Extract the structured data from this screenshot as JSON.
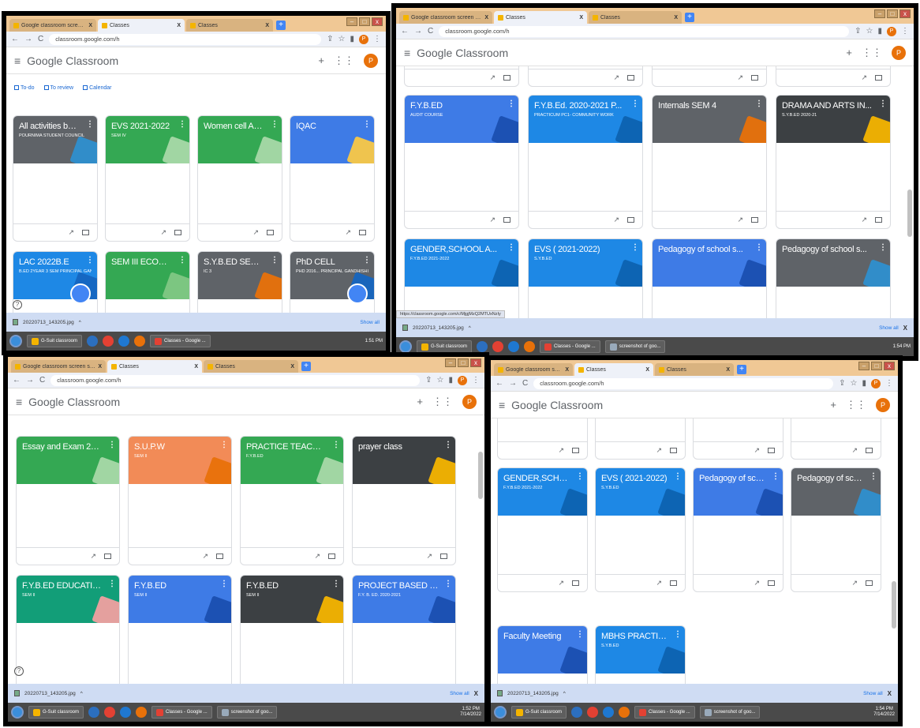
{
  "common": {
    "tabs": [
      {
        "label": "Google classroom screen shots",
        "close": "X"
      },
      {
        "label": "Classes",
        "close": "X"
      },
      {
        "label": "Classes",
        "close": "X"
      }
    ],
    "new_tab": "+",
    "url": "classroom.google.com/h",
    "app_title_g": "Google",
    "app_title_c": " Classroom",
    "avatar_initial": "P",
    "add": "+",
    "apps": "⋮⋮⋮",
    "download_file": "20220713_143205.jpg",
    "download_arrow": "^",
    "show_all": "Show all",
    "download_close": "X",
    "taskbar_gsuite": "G-Suit classroom",
    "taskbar_chrome": "Classes - Google ...",
    "taskbar_screenshot": "screenshot of goo...",
    "date": "7/14/2022",
    "help": "?",
    "more": "⋮",
    "trend": "↗"
  },
  "panel1": {
    "nav": [
      {
        "label": "To-do"
      },
      {
        "label": "To review"
      },
      {
        "label": "Calendar"
      }
    ],
    "time": "1:51 PM",
    "cards": [
      {
        "title": "All activities batch 20...",
        "sub": "Pournima Student council",
        "color": "#5f6368",
        "deco": "#2e8fcf"
      },
      {
        "title": "EVS 2021-2022",
        "sub": "SEM IV",
        "color": "#34a853",
        "deco": "#a8d8a8"
      },
      {
        "title": "Women cell Activities",
        "sub": "",
        "color": "#34a853",
        "deco": "#a8d8a8"
      },
      {
        "title": "IQAC",
        "sub": "",
        "color": "#3e7be6",
        "deco": "#f9c846"
      },
      {
        "title": "LAC 2022B.E",
        "sub": "B.Ed 2year 3 sem Principal Gandhishikshan",
        "color": "#1e88e5",
        "deco": "#1565c0"
      },
      {
        "title": "SEM III ECONOMICS",
        "sub": "",
        "color": "#34a853",
        "deco": "#81c784"
      },
      {
        "title": "S.Y.B.ED SEM III",
        "sub": "IC 3",
        "color": "#5f6368",
        "deco": "#e8710a"
      },
      {
        "title": "PhD CELL",
        "sub": "PhD 2016... Principal Gandhishikshan",
        "color": "#5f6368",
        "deco": "#1565c0"
      }
    ]
  },
  "panel2": {
    "status_url": "https://classroom.google.com/c/MjgjMzQ2MTUxNzIy",
    "time": "1:54 PM",
    "cards": [
      {
        "title": "F.Y.B.ED",
        "sub": "AUDIT COURSE",
        "color": "#3e7be6",
        "deco": "#1a4fb0"
      },
      {
        "title": "F.Y.B.Ed. 2020-2021 P...",
        "sub": "PRACTICUM PC1- COMMUNITY WORK",
        "color": "#1e88e5",
        "deco": "#0d62b0"
      },
      {
        "title": "Internals SEM 4",
        "sub": "",
        "color": "#5f6368",
        "deco": "#e8710a"
      },
      {
        "title": "DRAMA AND ARTS IN...",
        "sub": "S.Y.B.ED 2020-21",
        "color": "#3c4043",
        "deco": "#f4b400"
      },
      {
        "title": "GENDER,SCHOOL A...",
        "sub": "F.Y.B.ED 2021-2022",
        "color": "#1e88e5",
        "deco": "#0d62b0"
      },
      {
        "title": "EVS ( 2021-2022)",
        "sub": "S.Y.B.ED",
        "color": "#1e88e5",
        "deco": "#0d62b0"
      },
      {
        "title": "Pedagogy of school s...",
        "sub": "",
        "color": "#3e7be6",
        "deco": "#1a4fb0"
      },
      {
        "title": "Pedagogy of school s...",
        "sub": "",
        "color": "#5f6368",
        "deco": "#2e8fcf"
      }
    ]
  },
  "panel3": {
    "time": "1:52 PM",
    "cards": [
      {
        "title": "Essay and Exam 2021...",
        "sub": "",
        "color": "#34a853",
        "deco": "#a8d8a8"
      },
      {
        "title": "S.U.P.W",
        "sub": "SEM II",
        "color": "#f28b57",
        "deco": "#e8710a"
      },
      {
        "title": "PRACTICE TEACHING",
        "sub": "F.Y.B.ED",
        "color": "#34a853",
        "deco": "#a8d8a8"
      },
      {
        "title": "prayer class",
        "sub": "",
        "color": "#3c4043",
        "deco": "#f4b400"
      },
      {
        "title": "F.Y.B.ED EDUCATION...",
        "sub": "SEM II",
        "color": "#129e78",
        "deco": "#f0a0a0"
      },
      {
        "title": "F.Y.B.ED",
        "sub": "SEM II",
        "color": "#3e7be6",
        "deco": "#1a4fb0"
      },
      {
        "title": "F.Y.B.ED",
        "sub": "SEM II",
        "color": "#3c4043",
        "deco": "#f4b400"
      },
      {
        "title": "PROJECT BASED CO...",
        "sub": "F.Y. B. Ed. 2020-2021",
        "color": "#3e7be6",
        "deco": "#1a4fb0"
      }
    ]
  },
  "panel4": {
    "time": "1:54 PM",
    "cards": [
      {
        "title": "GENDER,SCHOOL A...",
        "sub": "F.Y.B.ED 2021-2022",
        "color": "#1e88e5",
        "deco": "#0d62b0"
      },
      {
        "title": "EVS ( 2021-2022)",
        "sub": "S.Y.B.ED",
        "color": "#1e88e5",
        "deco": "#0d62b0"
      },
      {
        "title": "Pedagogy of school s...",
        "sub": "",
        "color": "#3e7be6",
        "deco": "#1a4fb0"
      },
      {
        "title": "Pedagogy of school s...",
        "sub": "",
        "color": "#5f6368",
        "deco": "#2e8fcf"
      },
      {
        "title": "Faculty Meeting",
        "sub": "",
        "color": "#3e7be6",
        "deco": "#1a4fb0"
      },
      {
        "title": "MBHS PRACTICE TEA...",
        "sub": "S.Y.B.ED",
        "color": "#1e88e5",
        "deco": "#0d62b0"
      }
    ]
  }
}
